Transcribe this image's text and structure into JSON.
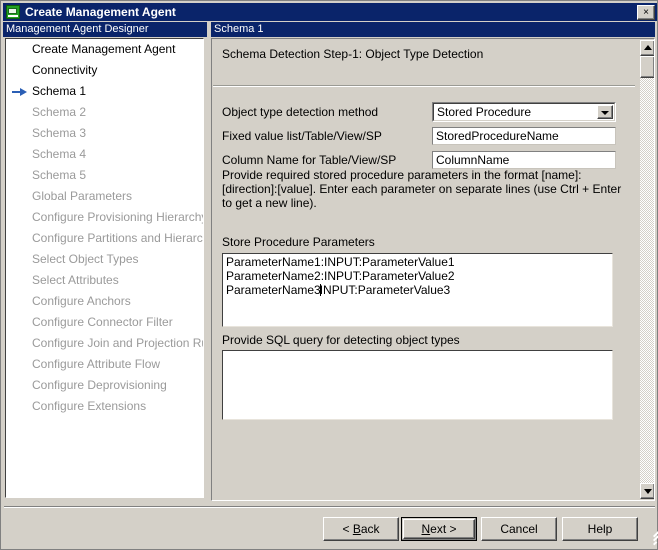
{
  "window": {
    "title": "Create Management Agent",
    "icon": "management-agent-icon",
    "close_label": "×"
  },
  "left_pane": {
    "header": "Management Agent Designer",
    "items": [
      {
        "label": "Create Management Agent",
        "state": "done",
        "current": false
      },
      {
        "label": "Connectivity",
        "state": "done",
        "current": false
      },
      {
        "label": "Schema 1",
        "state": "done",
        "current": true
      },
      {
        "label": "Schema 2",
        "state": "disabled",
        "current": false
      },
      {
        "label": "Schema 3",
        "state": "disabled",
        "current": false
      },
      {
        "label": "Schema 4",
        "state": "disabled",
        "current": false
      },
      {
        "label": "Schema 5",
        "state": "disabled",
        "current": false
      },
      {
        "label": "Global Parameters",
        "state": "disabled",
        "current": false
      },
      {
        "label": "Configure Provisioning Hierarchy",
        "state": "disabled",
        "current": false
      },
      {
        "label": "Configure Partitions and Hierarchies",
        "state": "disabled",
        "current": false
      },
      {
        "label": "Select Object Types",
        "state": "disabled",
        "current": false
      },
      {
        "label": "Select Attributes",
        "state": "disabled",
        "current": false
      },
      {
        "label": "Configure Anchors",
        "state": "disabled",
        "current": false
      },
      {
        "label": "Configure Connector Filter",
        "state": "disabled",
        "current": false
      },
      {
        "label": "Configure Join and Projection Rules",
        "state": "disabled",
        "current": false
      },
      {
        "label": "Configure Attribute Flow",
        "state": "disabled",
        "current": false
      },
      {
        "label": "Configure Deprovisioning",
        "state": "disabled",
        "current": false
      },
      {
        "label": "Configure Extensions",
        "state": "disabled",
        "current": false
      }
    ]
  },
  "right_pane": {
    "header": "Schema 1",
    "step_title": "Schema Detection Step-1:  Object Type Detection",
    "fields": {
      "detection_method": {
        "label": "Object type detection method",
        "value": "Stored Procedure"
      },
      "fixed_value_list": {
        "label": "Fixed value list/Table/View/SP",
        "value": "StoredProcedureName"
      },
      "column_name": {
        "label": "Column Name for Table/View/SP",
        "value": "ColumnName"
      }
    },
    "help_text": "Provide required stored procedure parameters in the format [name]:[direction]:[value]. Enter each parameter on separate lines (use Ctrl + Enter to get a new line).",
    "sp_params": {
      "label": "Store Procedure Parameters",
      "lines": [
        "ParameterName1:INPUT:ParameterValue1",
        "ParameterName2:INPUT:ParameterValue2"
      ],
      "caret_line_before": "ParameterName3",
      "caret_line_after": "INPUT:ParameterValue3"
    },
    "sql_query": {
      "label": "Provide SQL query for detecting object types",
      "value": ""
    },
    "scrollbar": {
      "up_icon": "scroll-up-arrow-icon",
      "down_icon": "scroll-down-arrow-icon"
    }
  },
  "footer": {
    "back": {
      "pre": "< ",
      "acc": "B",
      "post": "ack"
    },
    "next": {
      "pre": "",
      "acc": "N",
      "post": "ext >"
    },
    "cancel": "Cancel",
    "help": "Help"
  },
  "colors": {
    "titlebar": "#0a246a",
    "face": "#d4d0c8",
    "disabled_text": "#9a9a9a",
    "arrow_blue": "#2b5fb5"
  }
}
